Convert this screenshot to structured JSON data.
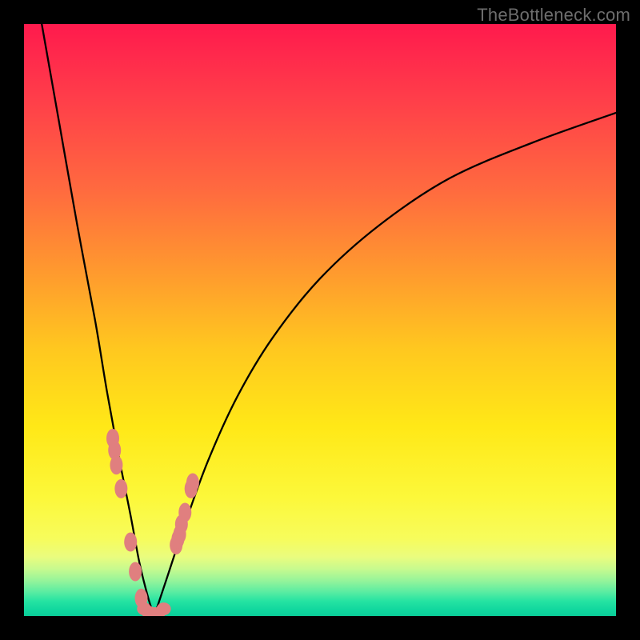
{
  "watermark": "TheBottleneck.com",
  "colors": {
    "top": "#ff1a4d",
    "mid": "#ffe817",
    "bottom": "#0acd99",
    "curve": "#000000",
    "dots": "#e07f7f",
    "frame": "#000000"
  },
  "chart_data": {
    "type": "line",
    "title": "",
    "xlabel": "",
    "ylabel": "",
    "xlim": [
      0,
      100
    ],
    "ylim": [
      0,
      100
    ],
    "grid": false,
    "note": "Background vertical gradient encodes value from red (high bottleneck) through yellow to green (low). The black V-shaped curve shows bottleneck vs component match; minimum near x≈22. Salmon dots mark measured data points clustered near the minimum of the curve.",
    "series": [
      {
        "name": "curve-left",
        "x": [
          3,
          6,
          9,
          12,
          14,
          16,
          18,
          19.5,
          21,
          22
        ],
        "values": [
          100,
          83,
          66,
          50,
          38,
          27,
          17,
          9,
          3,
          0
        ]
      },
      {
        "name": "curve-right",
        "x": [
          22,
          24,
          27,
          31,
          36,
          42,
          50,
          60,
          72,
          86,
          100
        ],
        "values": [
          0,
          6,
          15,
          26,
          37,
          47,
          57,
          66,
          74,
          80,
          85
        ]
      },
      {
        "name": "points-left-branch",
        "x": [
          15.0,
          15.3,
          15.6,
          16.4,
          18.0,
          18.8,
          19.8
        ],
        "values": [
          30,
          28,
          25.5,
          21.5,
          12.5,
          7.5,
          3.0
        ]
      },
      {
        "name": "points-right-branch",
        "x": [
          25.7,
          26.0,
          26.3,
          26.6,
          27.2,
          28.2,
          28.5
        ],
        "values": [
          12.0,
          13.0,
          13.8,
          15.5,
          17.5,
          21.5,
          22.5
        ]
      },
      {
        "name": "points-bottom",
        "x": [
          20.3,
          21.1,
          22.0,
          22.6,
          23.6
        ],
        "values": [
          1.2,
          0.6,
          0.4,
          0.4,
          1.2
        ]
      }
    ]
  }
}
